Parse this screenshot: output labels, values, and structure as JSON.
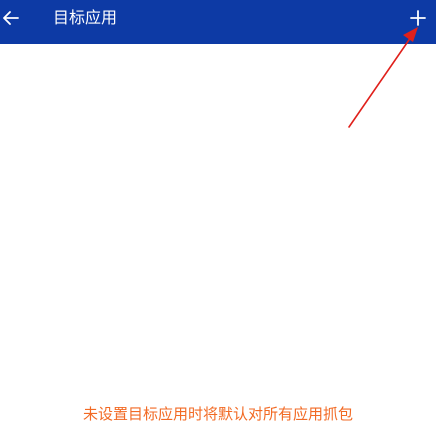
{
  "appbar": {
    "title": "目标应用",
    "background_color": "#0d3aa5",
    "back_icon": "arrow-left-icon",
    "add_icon": "plus-icon"
  },
  "empty_state": {
    "hint": "未设置目标应用时将默认对所有应用抓包",
    "hint_color": "#f26a24"
  },
  "annotation": {
    "arrow_color": "#e0201b"
  }
}
